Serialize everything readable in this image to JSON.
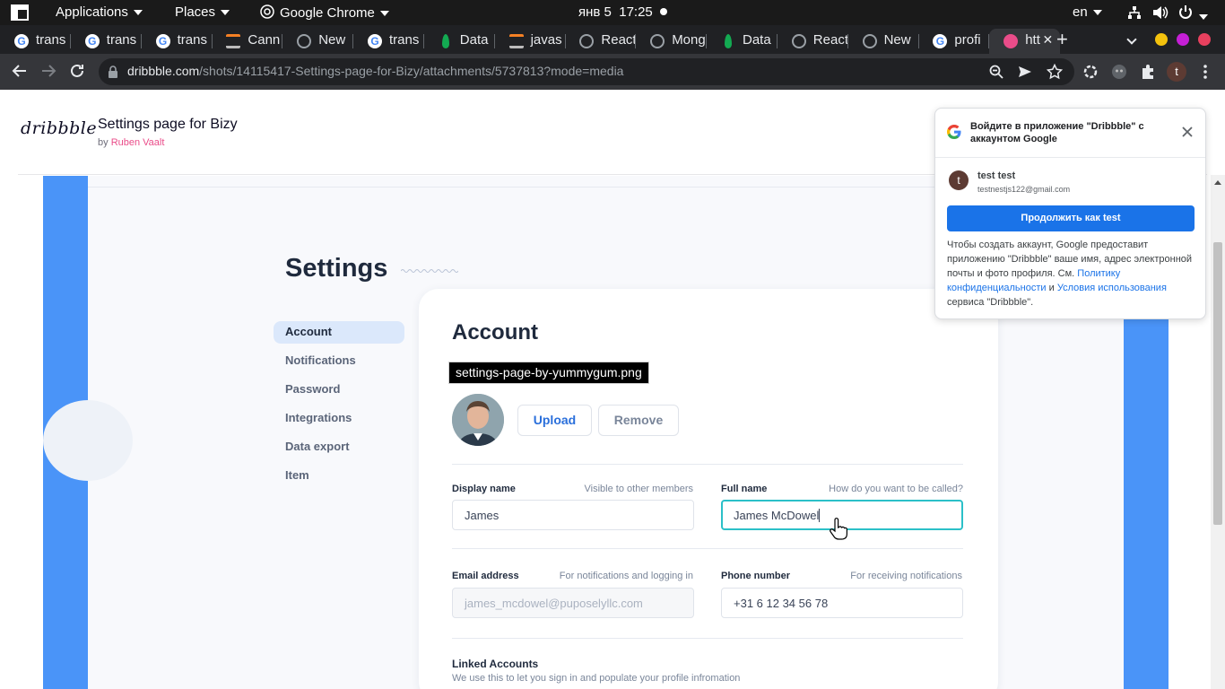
{
  "system_bar": {
    "applications": "Applications",
    "places": "Places",
    "browser_app": "Google Chrome",
    "date": "янв 5",
    "time": "17:25",
    "language": "en"
  },
  "tabs": [
    {
      "title": "trans",
      "icon": "google-icon"
    },
    {
      "title": "trans",
      "icon": "google-icon"
    },
    {
      "title": "trans",
      "icon": "google-icon"
    },
    {
      "title": "Cann",
      "icon": "stackoverflow-icon"
    },
    {
      "title": "New",
      "icon": "globe-icon"
    },
    {
      "title": "trans",
      "icon": "google-icon"
    },
    {
      "title": "Data",
      "icon": "mongodb-icon"
    },
    {
      "title": "javas",
      "icon": "stackoverflow-icon"
    },
    {
      "title": "React",
      "icon": "globe-icon"
    },
    {
      "title": "Mong",
      "icon": "globe-icon"
    },
    {
      "title": "Data",
      "icon": "mongodb-icon"
    },
    {
      "title": "React",
      "icon": "globe-icon"
    },
    {
      "title": "New",
      "icon": "globe-icon"
    },
    {
      "title": "profi",
      "icon": "google-icon"
    },
    {
      "title": "htt",
      "icon": "dribbble-icon",
      "active": true
    }
  ],
  "address": {
    "domain": "dribbble.com",
    "path": "/shots/14115417-Settings-page-for-Bizy/attachments/5737813?mode=media"
  },
  "profile_initial": "t",
  "shot": {
    "logo": "dribbble",
    "title": "Settings page for Bizy",
    "by_prefix": "by",
    "author": "Ruben Vaalt"
  },
  "design": {
    "settings_title": "Settings",
    "nav": [
      "Account",
      "Notifications",
      "Password",
      "Integrations",
      "Data export",
      "Item"
    ],
    "account_title": "Account",
    "tooltip": "settings-page-by-yummygum.png",
    "upload": "Upload",
    "remove": "Remove",
    "display_name_label": "Display name",
    "display_name_hint": "Visible to other members",
    "display_name_value": "James",
    "full_name_label": "Full name",
    "full_name_hint": "How do you want to be called?",
    "full_name_value": "James McDowel",
    "email_label": "Email address",
    "email_hint": "For notifications and logging in",
    "email_placeholder": "james_mcdowel@puposelyllc.com",
    "phone_label": "Phone number",
    "phone_hint": "For receiving notifications",
    "phone_value": "+31 6 12 34 56 78",
    "linked_title": "Linked Accounts",
    "linked_desc": "We use this to let you sign in and populate your profile infromation"
  },
  "google_popup": {
    "title": "Войдите в приложение \"Dribbble\" с аккаунтом Google",
    "account_initial": "t",
    "account_name": "test test",
    "account_email": "testnestjs122@gmail.com",
    "continue_button": "Продолжить как test",
    "disclaimer_1": "Чтобы создать аккаунт, Google предоставит приложению \"Dribbble\" ваше имя, адрес электронной почты и фото профиля. См.",
    "privacy_link": "Политику конфиденциальности",
    "and": "и",
    "terms_link": "Условия использования",
    "disclaimer_2": "сервиса \"Dribbble\"."
  },
  "colors": {
    "accent_pink": "#ea4c89",
    "google_blue": "#1a73e8",
    "artwork_blue": "#4a94f8",
    "input_focus": "#2bc0c8"
  }
}
